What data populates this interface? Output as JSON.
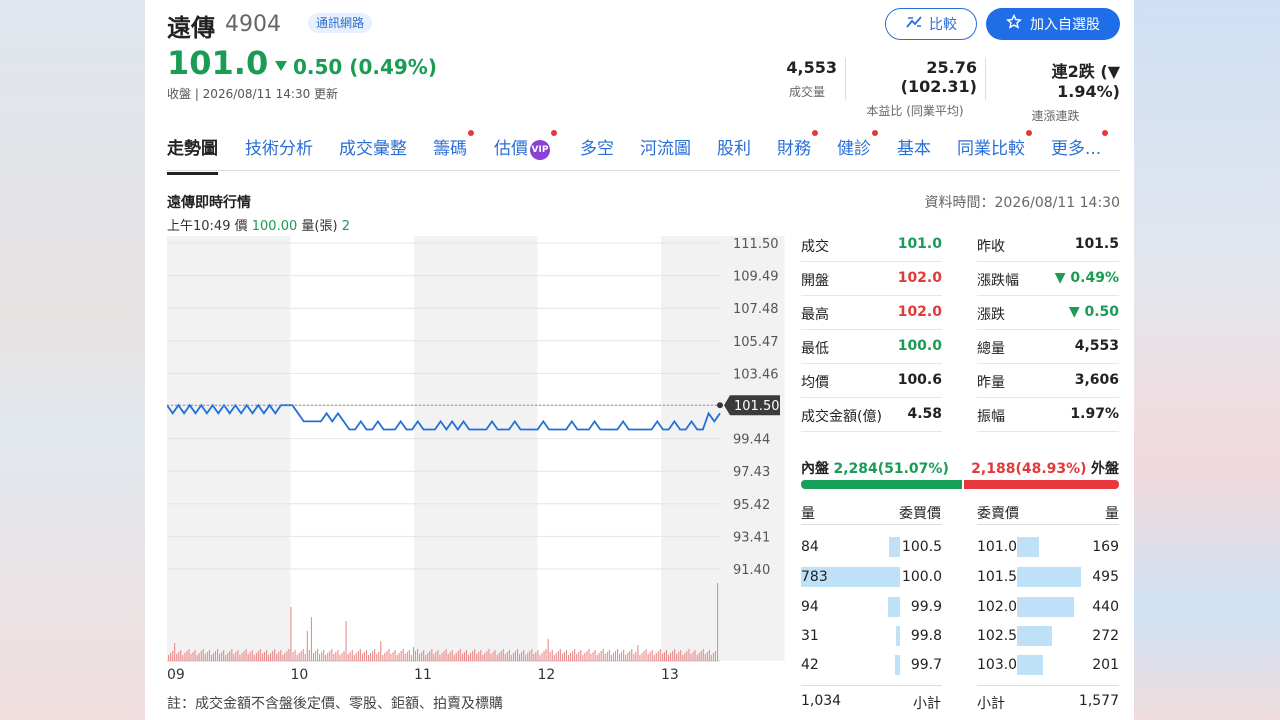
{
  "header": {
    "stock_name": "遠傳",
    "stock_code": "4904",
    "category_tag": "通訊網路",
    "compare_label": "比較",
    "add_watchlist_label": "加入自選股",
    "price": "101.0",
    "change": "0.50 (0.49%)",
    "updated": "收盤 | 2026/08/11 14:30 更新",
    "stats": [
      {
        "value": "4,553",
        "label": "成交量"
      },
      {
        "value": "25.76 (102.31)",
        "label": "本益比 (同業平均)"
      },
      {
        "value": "連2跌 (▼ 1.94%)",
        "label": "連漲連跌"
      }
    ]
  },
  "tabs": [
    {
      "label": "走勢圖",
      "dot": false
    },
    {
      "label": "技術分析",
      "dot": false
    },
    {
      "label": "成交彙整",
      "dot": false
    },
    {
      "label": "籌碼",
      "dot": true
    },
    {
      "label": "估價",
      "dot": true,
      "vip": "VIP"
    },
    {
      "label": "多空",
      "dot": false
    },
    {
      "label": "河流圖",
      "dot": false
    },
    {
      "label": "股利",
      "dot": false
    },
    {
      "label": "財務",
      "dot": true
    },
    {
      "label": "健診",
      "dot": true
    },
    {
      "label": "基本",
      "dot": false
    },
    {
      "label": "同業比較",
      "dot": true
    },
    {
      "label": "更多...",
      "dot": true
    }
  ],
  "section": {
    "title": "遠傳即時行情",
    "data_time": "資料時間：2026/08/11 14:30",
    "tick_time": "上午10:49",
    "tick_price_label": "價",
    "tick_price": "100.00",
    "tick_vol_label": "量(張)",
    "tick_vol": "2",
    "note": "註：成交金額不含盤後定價、零股、鉅額、拍賣及標購"
  },
  "chart_data": {
    "type": "line",
    "y_ticks": [
      "111.50",
      "109.49",
      "107.48",
      "105.47",
      "103.46",
      "101.50",
      "99.44",
      "97.43",
      "95.42",
      "93.41",
      "91.40"
    ],
    "y_range": [
      91.4,
      111.5
    ],
    "reference_price": 101.5,
    "reference_label": "101.50",
    "x_ticks": [
      "09",
      "10",
      "11",
      "12",
      "13"
    ],
    "price_pattern": [
      101.5,
      101.0,
      101.5,
      101.0,
      101.5,
      101.0,
      101.5,
      101.0,
      101.5,
      101.0,
      101.5,
      101.0,
      101.5,
      101.0,
      101.5,
      101.0,
      101.5,
      101.0,
      101.5,
      101.0,
      101.5,
      101.5,
      101.5,
      101.0,
      100.5,
      100.5,
      100.5,
      100.5,
      101.0,
      100.5,
      101.0,
      100.5,
      100.0,
      100.0,
      100.5,
      100.0,
      100.0,
      100.5,
      100.0,
      100.0,
      100.0,
      100.5,
      100.0,
      100.0,
      100.5,
      100.0,
      100.0,
      100.0,
      100.5,
      100.0,
      100.5,
      100.0,
      100.5,
      100.0,
      100.0,
      100.0,
      100.0,
      100.5,
      100.0,
      100.0,
      100.0,
      100.5,
      100.0,
      100.0,
      100.0,
      100.0,
      100.5,
      100.0,
      100.0,
      100.0,
      100.0,
      100.5,
      100.0,
      100.0,
      100.0,
      100.5,
      100.0,
      100.0,
      100.0,
      100.0,
      100.5,
      100.0,
      100.0,
      100.0,
      100.0,
      100.0,
      100.5,
      100.0,
      100.0,
      100.5,
      100.0,
      100.0,
      100.5,
      100.0,
      100.0,
      101.0,
      100.5,
      101.0
    ],
    "volume_note": "minute volume bars, mostly small with spikes near 10:00 and a large final bar at close"
  },
  "quote": {
    "rows": [
      {
        "l1": "成交",
        "v1": "101.0",
        "c1": "grn",
        "l2": "昨收",
        "v2": "101.5",
        "c2": ""
      },
      {
        "l1": "開盤",
        "v1": "102.0",
        "c1": "red",
        "l2": "漲跌幅",
        "v2": "▼ 0.49%",
        "c2": "grn"
      },
      {
        "l1": "最高",
        "v1": "102.0",
        "c1": "red",
        "l2": "漲跌",
        "v2": "▼ 0.50",
        "c2": "grn"
      },
      {
        "l1": "最低",
        "v1": "100.0",
        "c1": "grn",
        "l2": "總量",
        "v2": "4,553",
        "c2": ""
      },
      {
        "l1": "均價",
        "v1": "100.6",
        "c1": "",
        "l2": "昨量",
        "v2": "3,606",
        "c2": ""
      },
      {
        "l1": "成交金額(億)",
        "v1": "4.58",
        "c1": "",
        "l2": "振幅",
        "v2": "1.97%",
        "c2": ""
      }
    ],
    "inner_label": "內盤",
    "inner_value": "2,284(51.07%)",
    "inner_fraction": 0.5107,
    "outer_value": "2,188(48.93%)",
    "outer_label": "外盤"
  },
  "orderbook": {
    "h_bid_qty": "量",
    "h_bid_price": "委買價",
    "h_ask_price": "委賣價",
    "h_ask_qty": "量",
    "bids": [
      {
        "qty": "84",
        "price": "100.5",
        "fill": 0.11
      },
      {
        "qty": "783",
        "price": "100.0",
        "fill": 1.0
      },
      {
        "qty": "94",
        "price": "99.9",
        "fill": 0.12
      },
      {
        "qty": "31",
        "price": "99.8",
        "fill": 0.04
      },
      {
        "qty": "42",
        "price": "99.7",
        "fill": 0.05
      }
    ],
    "asks": [
      {
        "price": "101.0",
        "qty": "169",
        "fill": 0.34
      },
      {
        "price": "101.5",
        "qty": "495",
        "fill": 1.0
      },
      {
        "price": "102.0",
        "qty": "440",
        "fill": 0.89
      },
      {
        "price": "102.5",
        "qty": "272",
        "fill": 0.55
      },
      {
        "price": "103.0",
        "qty": "201",
        "fill": 0.41
      }
    ],
    "bid_total": "1,034",
    "bid_total_label": "小計",
    "ask_total_label": "小計",
    "ask_total": "1,577"
  }
}
